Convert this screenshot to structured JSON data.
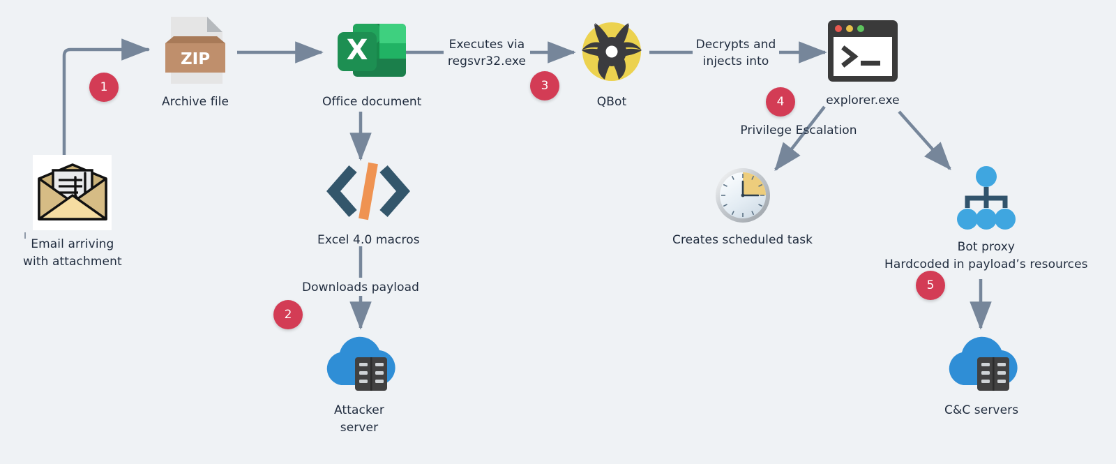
{
  "diagram": {
    "title": "QBot infection chain",
    "background_color": "#eff2f5",
    "accent_badge_color": "#d33c55",
    "connector_color": "#76869a",
    "text_color": "#1f2b3d"
  },
  "nodes": [
    {
      "id": "email",
      "icon": "email-attachment-icon",
      "label": "Email arriving\nwith attachment"
    },
    {
      "id": "archive",
      "icon": "zip-archive-icon",
      "icon_text": "ZIP",
      "label": "Archive file"
    },
    {
      "id": "office",
      "icon": "excel-document-icon",
      "icon_text": "X",
      "label": "Office document"
    },
    {
      "id": "qbot",
      "icon": "qbot-malware-icon",
      "label": "QBot"
    },
    {
      "id": "explorer",
      "icon": "terminal-window-icon",
      "icon_text": ">_",
      "label": "explorer.exe"
    },
    {
      "id": "macros",
      "icon": "code-brackets-icon",
      "label": "Excel 4.0 macros"
    },
    {
      "id": "attacker",
      "icon": "cloud-server-icon",
      "label": "Attacker\nserver"
    },
    {
      "id": "scheduled_task",
      "icon": "clock-icon",
      "label": "Creates scheduled task"
    },
    {
      "id": "bot_proxy",
      "icon": "network-hierarchy-icon",
      "label": "Bot proxy\nHardcoded in payload’s resources"
    },
    {
      "id": "cnc",
      "icon": "cloud-server-icon",
      "label": "C&C servers"
    }
  ],
  "edge_labels": [
    {
      "id": "executes_via",
      "text": "Executes via\nregsvr32.exe"
    },
    {
      "id": "decrypts_injects",
      "text": "Decrypts and\ninjects into"
    },
    {
      "id": "downloads_payload",
      "text": "Downloads payload"
    },
    {
      "id": "privilege_escalation",
      "text": "Privilege Escalation"
    }
  ],
  "badges": [
    {
      "id": "step-1",
      "number": "1"
    },
    {
      "id": "step-2",
      "number": "2"
    },
    {
      "id": "step-3",
      "number": "3"
    },
    {
      "id": "step-4",
      "number": "4"
    },
    {
      "id": "step-5",
      "number": "5"
    }
  ]
}
